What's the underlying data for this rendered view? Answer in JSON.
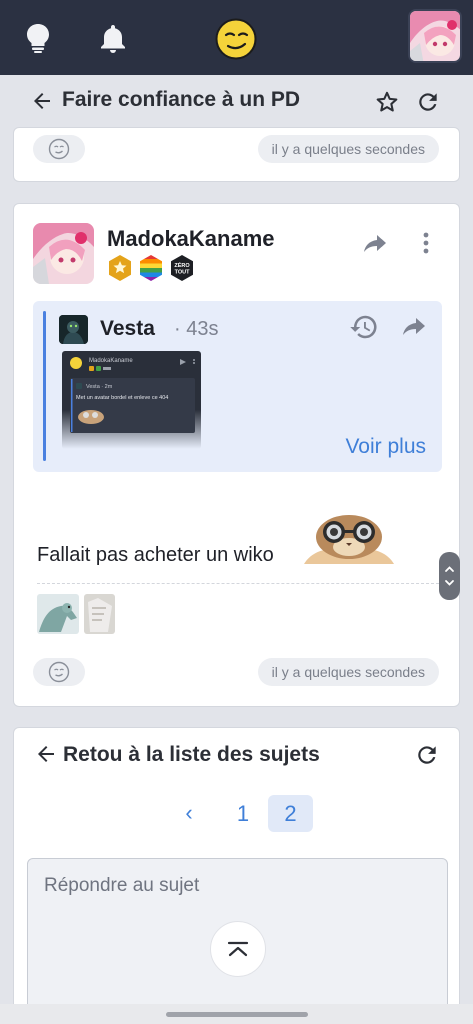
{
  "topbar": {
    "icons": [
      "lightbulb-icon",
      "bell-icon",
      "smiley-logo",
      "user-avatar"
    ],
    "colors": {
      "background": "#2b3142",
      "accent": "#f5d33a"
    }
  },
  "subheader": {
    "back_icon": "arrow-left-icon",
    "title": "Faire confiance à un PD",
    "star_icon": "star-outline-icon",
    "refresh_icon": "refresh-icon"
  },
  "prev_post": {
    "time": "il y a quelques secondes"
  },
  "post": {
    "author": "MadokaKaname",
    "badges": [
      "star-badge",
      "rainbow-badge",
      "zero-tout-badge"
    ],
    "badge_text": "ZÉRO TOUT",
    "quote": {
      "author": "Vesta",
      "separator": "·",
      "time": "43s",
      "thumb_author": "MadokaKaname",
      "thumb_reply_author": "Vesta · 2m",
      "thumb_text": "Met un avatar bordel et enleve ce 404",
      "more": "Voir plus"
    },
    "message": "Fallait pas acheter un wiko",
    "time": "il y a quelques secondes"
  },
  "bottom": {
    "title": "Retou à la liste des sujets",
    "pager": {
      "prev": "‹",
      "pages": [
        "1",
        "2"
      ],
      "current": "2"
    },
    "reply_placeholder": "Répondre au sujet"
  }
}
